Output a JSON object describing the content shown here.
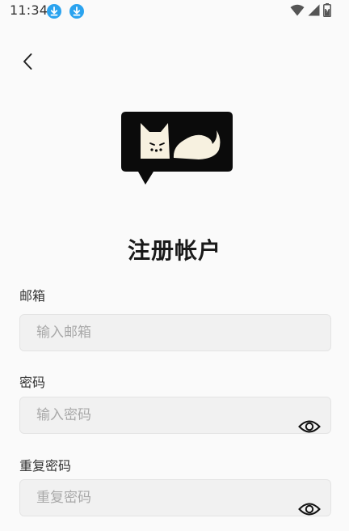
{
  "status_bar": {
    "time": "11:34",
    "icons": [
      "download-icon",
      "download-icon",
      "wifi-icon",
      "cell-signal-icon",
      "battery-icon"
    ]
  },
  "nav": {
    "back_icon": "chevron-left-icon"
  },
  "logo": {
    "icon": "cat-chat-bubble-logo"
  },
  "title": "注册帐户",
  "form": {
    "email": {
      "label": "邮箱",
      "placeholder": "输入邮箱",
      "value": ""
    },
    "password": {
      "label": "密码",
      "placeholder": "输入密码",
      "value": "",
      "toggle_icon": "eye-icon"
    },
    "confirm_password": {
      "label": "重复密码",
      "placeholder": "重复密码",
      "value": "",
      "toggle_icon": "eye-icon"
    }
  },
  "colors": {
    "background": "#fafafa",
    "input_background": "#f1f1f1",
    "download_badge": "#2aa3ef",
    "logo_dark": "#0b0b0b",
    "logo_light": "#f7f1e0"
  }
}
